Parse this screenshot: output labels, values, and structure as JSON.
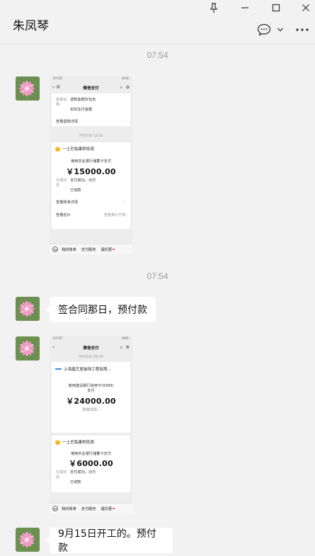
{
  "window": {
    "contact_name": "朱凤琴",
    "icons": [
      "pin-icon",
      "minimize-icon",
      "maximize-icon",
      "close-icon",
      "chat-bubble-icon",
      "chevron-down-icon",
      "more-icon"
    ]
  },
  "chat": {
    "timestamps": [
      "07:54",
      "07:54"
    ],
    "messages": [
      {
        "type": "image",
        "content": "wechat-pay-screenshot-1"
      },
      {
        "type": "text",
        "text": "签合同那日，预付款"
      },
      {
        "type": "image",
        "content": "wechat-pay-screenshot-2"
      },
      {
        "type": "text",
        "text": "9月15日开工的。预付款"
      }
    ]
  },
  "shot1": {
    "status_time": "07:52",
    "status_batt": "41%",
    "title": "微信支付",
    "back": "‹ ②",
    "refund_key": "金额说明",
    "refund_value_1": "退款金额仅包含",
    "refund_value_2": "实际支付金额",
    "refund_link": "查看退款详情",
    "date": "7月25日 12:52",
    "merchant": "一土巴兔康桥低调",
    "desc": "使用农业银行储蓄卡支付",
    "amount": "￥15000.00",
    "status_key": "交易状态",
    "status_value_1": "支付成功，对方",
    "status_value_2": "已收款",
    "bill_link": "查看账单详情",
    "card_left": "查看名片",
    "card_right": "查看累计付款",
    "menu": [
      "我的账单",
      "支付服务",
      "福优惠"
    ]
  },
  "shot2": {
    "status_time": "07:55",
    "status_batt": "40%",
    "title": "微信支付",
    "back": "‹",
    "date": "9月15日 09:34",
    "merchant_1": "上海鑫艺居装饰工程有限…",
    "desc_1a": "使用建设银行信用卡(9389)",
    "desc_1b": "支付",
    "amount_1": "￥24000.00",
    "detail_link": "账单详情",
    "merchant_2": "一土巴兔康桥低调",
    "desc_2": "使用农业银行储蓄卡支付",
    "amount_2": "￥6000.00",
    "status_key": "交易状态",
    "status_value_1": "支付成功，对方",
    "status_value_2": "已收款",
    "menu": [
      "我的账单",
      "支付服务",
      "福优惠"
    ]
  },
  "colors": {
    "bg": "#f2f2f2",
    "bubble": "#ffffff",
    "accent_red": "#e64340",
    "gold": "#f3b516"
  }
}
